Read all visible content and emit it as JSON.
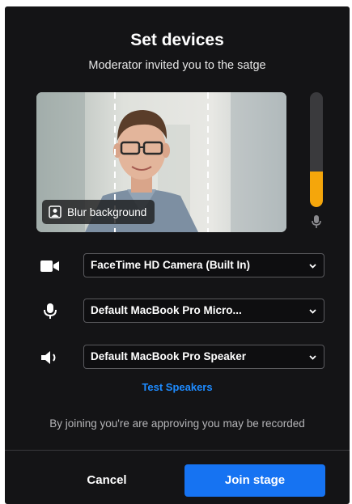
{
  "dialog": {
    "title": "Set devices",
    "subtitle": "Moderator invited you to the satge"
  },
  "preview": {
    "blur_label": "Blur background",
    "mic_level_fraction": 0.31
  },
  "devices": {
    "camera": {
      "icon": "video-camera-icon",
      "value": "FaceTime HD Camera (Built In)"
    },
    "microphone": {
      "icon": "microphone-icon",
      "value": "Default MacBook Pro Micro..."
    },
    "speaker": {
      "icon": "speaker-icon",
      "value": "Default MacBook Pro Speaker"
    }
  },
  "test_speakers_label": "Test Speakers",
  "notice": "By joining you're are approving you may be recorded",
  "footer": {
    "cancel_label": "Cancel",
    "join_label": "Join stage"
  },
  "colors": {
    "background": "#141416",
    "accent": "#1673f2",
    "link": "#1e8bff",
    "meter": "#f5a60b"
  }
}
